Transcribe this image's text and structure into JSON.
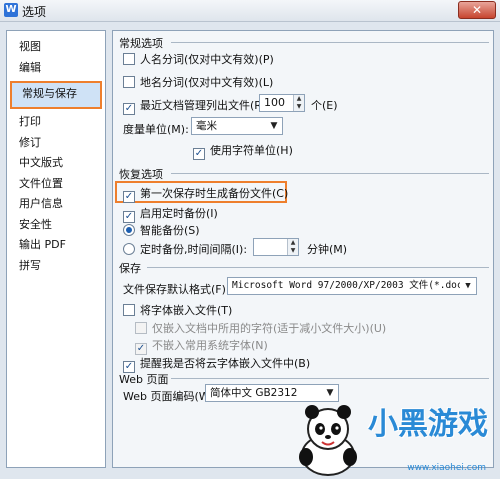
{
  "window": {
    "title": "选项",
    "app_icon_letter": "W",
    "close_label": "✕"
  },
  "sidebar": {
    "items": [
      {
        "label": "视图"
      },
      {
        "label": "编辑"
      },
      {
        "label": "常规与保存",
        "selected": true
      },
      {
        "label": "打印"
      },
      {
        "label": "修订"
      },
      {
        "label": "中文版式"
      },
      {
        "label": "文件位置"
      },
      {
        "label": "用户信息"
      },
      {
        "label": "安全性"
      },
      {
        "label": "输出 PDF"
      },
      {
        "label": "拼写"
      }
    ]
  },
  "general": {
    "title": "常规选项",
    "name_segmentation": {
      "label": "人名分词(仅对中文有效)(P)",
      "checked": false
    },
    "place_segmentation": {
      "label": "地名分词(仅对中文有效)(L)",
      "checked": false
    },
    "recent_docs": {
      "label": "最近文档管理列出文件(R):",
      "checked": true,
      "value": "100",
      "unit": "个(E)"
    },
    "measure_unit": {
      "label": "度量单位(M):",
      "value": "毫米"
    },
    "use_char_unit": {
      "label": "使用字符单位(H)",
      "checked": true
    }
  },
  "recovery": {
    "title": "恢复选项",
    "first_save_backup": {
      "label": "第一次保存时生成备份文件(C)",
      "checked": true
    },
    "timed_backup": {
      "label": "启用定时备份(I)",
      "checked": true
    },
    "smart_backup": {
      "label": "智能备份(S)",
      "selected": true
    },
    "interval_backup": {
      "label": "定时备份,时间间隔(I):",
      "selected": false,
      "value": "",
      "unit": "分钟(M)"
    }
  },
  "save": {
    "title": "保存",
    "default_format": {
      "label": "文件保存默认格式(F):",
      "value": "Microsoft Word 97/2000/XP/2003 文件(*.doc)"
    },
    "embed_fonts": {
      "label": "将字体嵌入文件(T)",
      "checked": false
    },
    "embed_used_chars": {
      "label": "仅嵌入文档中所用的字符(适于减小文件大小)(U)",
      "checked": false,
      "disabled": true
    },
    "no_common_fonts": {
      "label": "不嵌入常用系统字体(N)",
      "checked": true,
      "disabled": true
    },
    "remind_cloud_fonts": {
      "label": "提醒我是否将云字体嵌入文件中(B)",
      "checked": true
    }
  },
  "web": {
    "title": "Web 页面",
    "encoding": {
      "label": "Web 页面编码(W):",
      "value": "简体中文 GB2312"
    }
  },
  "watermark": {
    "brand": "小黑游戏",
    "url": "www.xiaohei.com"
  },
  "colors": {
    "highlight": "#ee7f2d",
    "selection_bg": "#cfe2f6",
    "window_bg": "#dfe6ee"
  }
}
